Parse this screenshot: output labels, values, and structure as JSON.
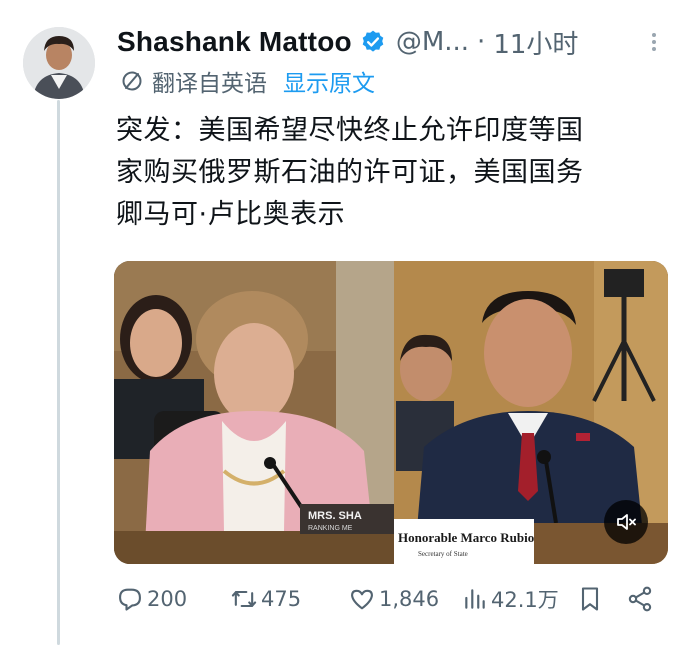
{
  "author": {
    "name": "Shashank Mattoo",
    "handle": "@M...",
    "separator": "·",
    "time": "11小时"
  },
  "translation": {
    "label": "翻译自英语",
    "show_original": "显示原文"
  },
  "tweet": {
    "lines": [
      "突发：美国希望尽快终止允许印度等国",
      "家购买俄罗斯石油的许可证，美国国务",
      "卿马可·卢比奥表示"
    ]
  },
  "media": {
    "left_nameplate_line1": "MRS. SHA",
    "left_nameplate_line2": "RANKING ME",
    "right_nameplate_line1": "Honorable Marco Rubio",
    "right_nameplate_line2": "Secretary of State"
  },
  "actions": {
    "replies": "200",
    "reposts": "475",
    "likes": "1,846",
    "views": "42.1万"
  },
  "colors": {
    "accent": "#1d9bf0",
    "muted_text": "#536471",
    "thread_line": "#cfd9de"
  },
  "icons": [
    "verified-badge-icon",
    "more-icon",
    "translate-icon",
    "mute-icon",
    "reply-icon",
    "repost-icon",
    "like-icon",
    "views-icon",
    "bookmark-icon",
    "share-icon"
  ]
}
